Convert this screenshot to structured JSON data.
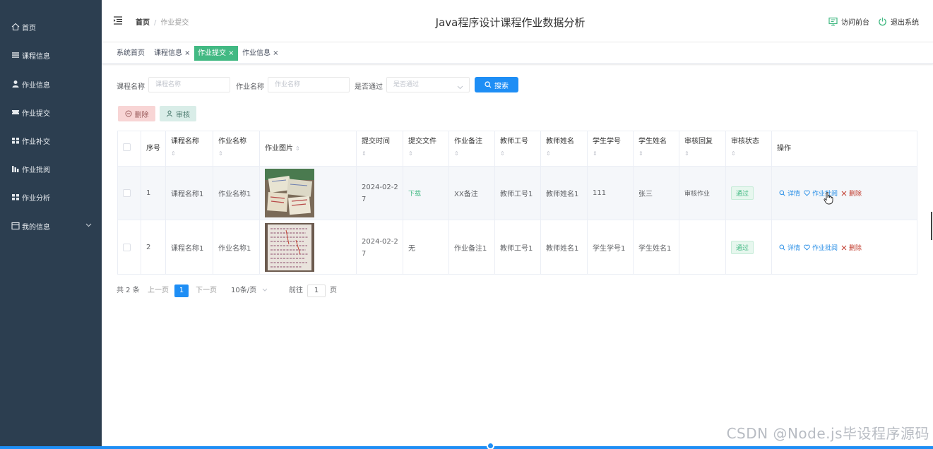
{
  "sidebar": {
    "items": [
      {
        "label": "首页",
        "icon": "home-icon"
      },
      {
        "label": "课程信息",
        "icon": "list-icon"
      },
      {
        "label": "作业信息",
        "icon": "user-icon"
      },
      {
        "label": "作业提交",
        "icon": "ticket-icon"
      },
      {
        "label": "作业补交",
        "icon": "grid-icon"
      },
      {
        "label": "作业批阅",
        "icon": "chart-icon"
      },
      {
        "label": "作业分析",
        "icon": "grid-icon"
      },
      {
        "label": "我的信息",
        "icon": "window-icon"
      }
    ]
  },
  "header": {
    "breadcrumb_home": "首页",
    "breadcrumb_current": "作业提交",
    "title": "Java程序设计课程作业数据分析",
    "visit_front": "访问前台",
    "logout": "退出系统"
  },
  "tags": [
    {
      "label": "系统首页"
    },
    {
      "label": "课程信息 ×"
    },
    {
      "label": "作业提交 ×"
    },
    {
      "label": "作业信息 ×"
    }
  ],
  "search": {
    "course_label": "课程名称",
    "course_placeholder": "课程名称",
    "hw_label": "作业名称",
    "hw_placeholder": "作业名称",
    "pass_label": "是否通过",
    "pass_placeholder": "是否通过",
    "search_btn": "搜索"
  },
  "actions": {
    "delete": "删除",
    "audit": "审核"
  },
  "table": {
    "headers": {
      "index": "序号",
      "course": "课程名称",
      "hw": "作业名称",
      "image": "作业图片",
      "time": "提交时间",
      "file": "提交文件",
      "note": "作业备注",
      "tid": "教师工号",
      "tname": "教师姓名",
      "sid": "学生学号",
      "sname": "学生姓名",
      "reply": "审核回复",
      "status": "审核状态",
      "ops": "操作"
    },
    "sort_glyph": "⇕",
    "rows": [
      {
        "index": "1",
        "course": "课程名称1",
        "hw": "作业名称1",
        "time_l1": "2024-02-2",
        "time_l2": "7",
        "file": "下载",
        "note": "XX备注",
        "tid": "教师工号1",
        "tname": "教师姓名1",
        "sid": "111",
        "sname": "张三",
        "reply": "审核作业",
        "status": "通过"
      },
      {
        "index": "2",
        "course": "课程名称1",
        "hw": "作业名称1",
        "time_l1": "2024-02-2",
        "time_l2": "7",
        "file": "无",
        "note": "作业备注1",
        "tid": "教师工号1",
        "tname": "教师姓名1",
        "sid": "学生学号1",
        "sname": "学生姓名1",
        "reply": "",
        "status": "通过"
      }
    ],
    "op_detail": "详情",
    "op_review": "作业批阅",
    "op_delete": "删除"
  },
  "pagination": {
    "total": "共 2 条",
    "prev": "上一页",
    "current": "1",
    "next": "下一页",
    "per_page": "10条/页",
    "goto": "前往",
    "goto_value": "1",
    "page_unit": "页"
  },
  "watermark": "CSDN @Node.js毕设程序源码",
  "colors": {
    "sidebar": "#2c3e50",
    "accent": "#1e8ef5",
    "active_tag": "#42b983"
  }
}
